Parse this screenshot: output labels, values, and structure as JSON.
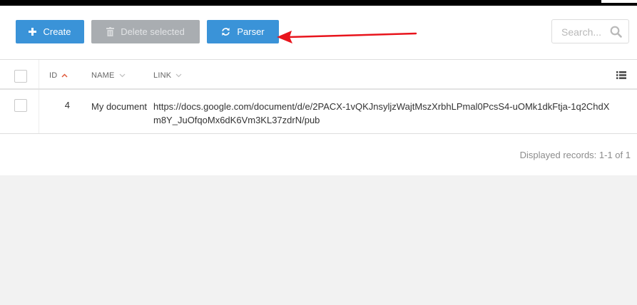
{
  "toolbar": {
    "create_label": "Create",
    "delete_label": "Delete selected",
    "parser_label": "Parser",
    "search_placeholder": "Search..."
  },
  "table": {
    "columns": [
      "ID",
      "NAME",
      "LINK"
    ],
    "sort": {
      "column": "ID",
      "direction": "ascending"
    },
    "rows": [
      {
        "id": "4",
        "name": "My document",
        "link": "https://docs.google.com/document/d/e/2PACX-1vQKJnsyljzWajtMszXrbhLPmal0PcsS4-uOMk1dkFtja-1q2ChdXm8Y_JuOfqoMx6dK6Vm3KL37zdrN/pub"
      }
    ]
  },
  "footer": {
    "records_info": "Displayed records: 1-1 of 1"
  },
  "colors": {
    "primary": "#3a93d8",
    "disabled": "#a9adb1",
    "annotation_arrow": "#e8141c"
  },
  "icons": {
    "create": "plus-icon",
    "delete": "trash-icon",
    "parser": "refresh-icon",
    "search": "search-icon",
    "columns": "list-icon"
  }
}
